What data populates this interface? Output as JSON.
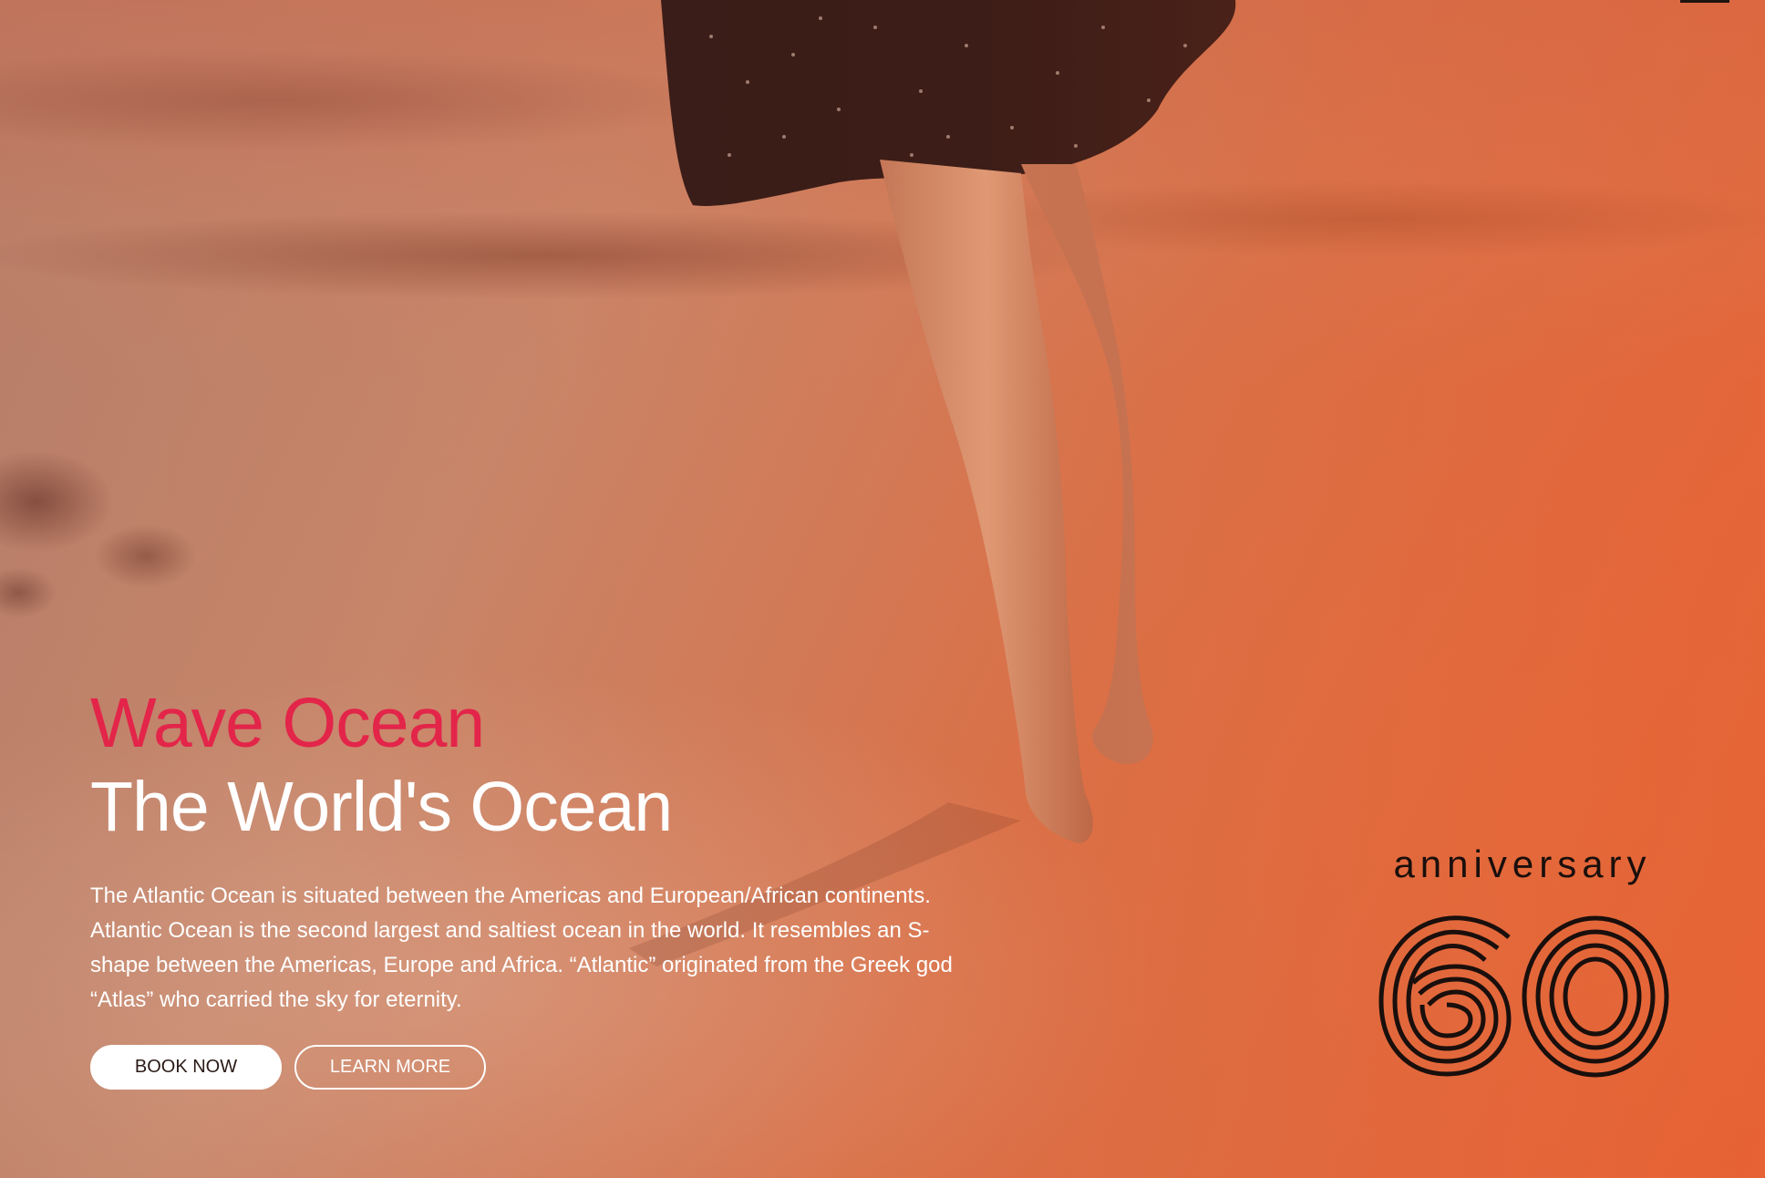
{
  "hero": {
    "kicker": "Wave Ocean",
    "title": "The World's Ocean",
    "description": "The Atlantic Ocean is situated between the Americas and European/African continents. Atlantic Ocean is the second largest and saltiest ocean in the world. It resembles an S-shape between the Americas, Europe and Africa. “Atlantic” originated from the Greek god “Atlas” who carried the sky for eternity.",
    "buttons": {
      "primary": "BOOK NOW",
      "secondary": "LEARN MORE"
    }
  },
  "badge": {
    "label": "anniversary",
    "number": "60"
  },
  "colors": {
    "accent": "#e3254a",
    "text": "#ffffff",
    "badge": "#1a0f0c"
  },
  "icons": {
    "menu": "menu-icon"
  }
}
